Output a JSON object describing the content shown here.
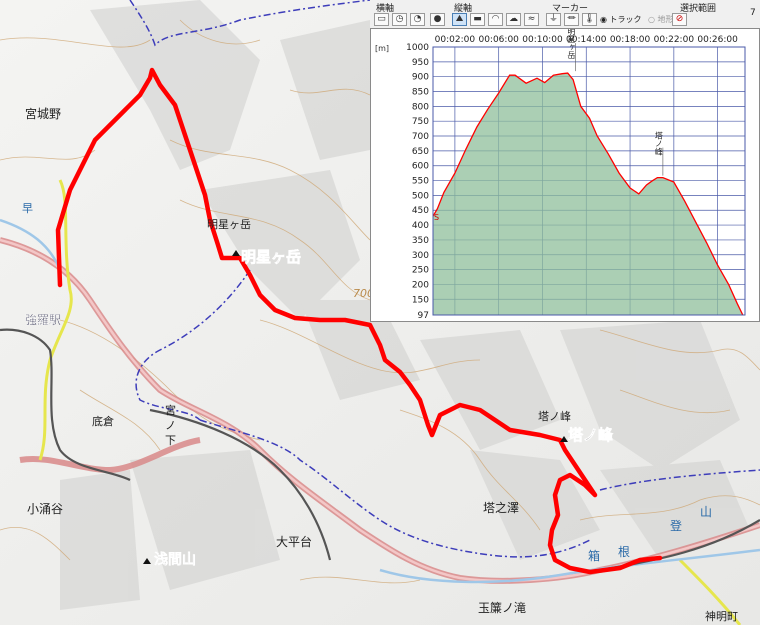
{
  "map": {
    "labels": {
      "miyagino": "宮城野",
      "gora_station": "強羅駅",
      "myojogatake_small": "明星ヶ岳",
      "myojogatake_big": "明星ヶ岳",
      "contour_700": "700",
      "sokura": "底倉",
      "miyanoshita_1": "宮",
      "miyanoshita_2": "ノ",
      "miyanoshita_3": "下",
      "kowakudani": "小涌谷",
      "tonomine_small": "塔ノ峰",
      "tonomine_big": "塔ノ峰",
      "tonosawa": "塔之澤",
      "ohiradai": "大平台",
      "sengenyama": "浅間山",
      "tamadare": "玉簾ノ滝",
      "shinmeicho": "神明町",
      "river_1": "箱",
      "river_2": "根",
      "river_3": "登",
      "river_4": "山",
      "hayakawa": "早"
    },
    "colors": {
      "track": "#ff0000",
      "road": "#d98a8a",
      "river": "#9fc7e8",
      "boundary": "#3d3dba",
      "rail": "#555555",
      "contour": "#c9a36a"
    }
  },
  "toolbar": {
    "yokojiku": "横軸",
    "tatejiku": "縦軸",
    "marker": "マーカー",
    "selection": "選択範囲",
    "track_option": "トラック",
    "terrain_option": "地形",
    "extra": "7",
    "icons": [
      "distance-icon",
      "time-icon",
      "clock-icon",
      "elevation-icon",
      "speed-icon",
      "slope-icon",
      "cloud-icon",
      "plug-in-icon",
      "plug-out-icon",
      "thermometer-icon"
    ]
  },
  "chart_data": {
    "type": "area",
    "unit_label": "[m]",
    "x_ticks": [
      "00:02:00",
      "00:06:00",
      "00:10:00",
      "00:14:00",
      "00:18:00",
      "00:22:00",
      "00:26:00"
    ],
    "y_ticks": [
      1000,
      950,
      900,
      850,
      800,
      750,
      700,
      650,
      600,
      550,
      500,
      450,
      400,
      350,
      300,
      250,
      200,
      150,
      97
    ],
    "ylim": [
      97,
      1000
    ],
    "xlim_minutes": [
      0,
      28.5
    ],
    "elevation_profile": {
      "time_minutes": [
        0.0,
        0.4,
        1.0,
        2.0,
        3.0,
        4.0,
        5.0,
        6.0,
        7.0,
        7.5,
        8.5,
        9.5,
        10.2,
        11.0,
        11.8,
        12.3,
        12.8,
        13.5,
        14.3,
        15.0,
        16.0,
        17.0,
        18.0,
        18.8,
        19.5,
        20.0,
        20.5,
        21.0,
        22.0,
        23.0,
        24.0,
        25.0,
        26.0,
        27.0,
        27.8,
        28.3
      ],
      "elevation_m": [
        430,
        455,
        510,
        575,
        655,
        730,
        790,
        845,
        905,
        905,
        878,
        895,
        880,
        905,
        910,
        912,
        890,
        800,
        760,
        700,
        640,
        575,
        525,
        505,
        535,
        548,
        560,
        560,
        545,
        480,
        410,
        340,
        265,
        200,
        135,
        97
      ]
    },
    "annotations": [
      {
        "text": "明星ヶ岳",
        "time_minutes": 13.0,
        "elevation_m": 912
      },
      {
        "text": "塔ノ峰",
        "time_minutes": 21.0,
        "elevation_m": 560
      },
      {
        "text": "S",
        "time_minutes": 0.0,
        "elevation_m": 430
      }
    ],
    "grid": true,
    "fill_color": "#8fbf9b",
    "line_color": "#ff0000"
  }
}
